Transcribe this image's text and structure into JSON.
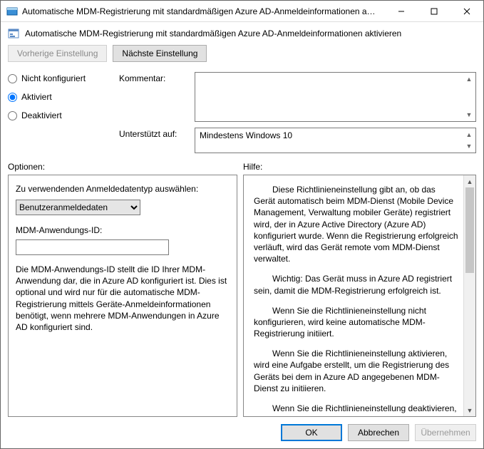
{
  "window": {
    "title": "Automatische MDM-Registrierung mit standardmäßigen Azure AD-Anmeldeinformationen akti..."
  },
  "header": {
    "title": "Automatische MDM-Registrierung mit standardmäßigen Azure AD-Anmeldeinformationen aktivieren"
  },
  "nav": {
    "prev": "Vorherige Einstellung",
    "next": "Nächste Einstellung"
  },
  "radios": {
    "not_configured": "Nicht konfiguriert",
    "enabled": "Aktiviert",
    "disabled": "Deaktiviert"
  },
  "labels": {
    "comment": "Kommentar:",
    "supported": "Unterstützt auf:",
    "options": "Optionen:",
    "help": "Hilfe:"
  },
  "supported_value": "Mindestens Windows 10",
  "options": {
    "cred_type_label": "Zu verwendenden Anmeldedatentyp auswählen:",
    "cred_type_value": "Benutzeranmeldedaten",
    "appid_label": "MDM-Anwendungs-ID:",
    "appid_value": "",
    "desc": "Die MDM-Anwendungs-ID stellt die ID Ihrer MDM-Anwendung dar, die in Azure AD konfiguriert ist. Dies ist optional und wird nur für die automatische MDM-Registrierung mittels Geräte-Anmeldeinformationen benötigt, wenn mehrere MDM-Anwendungen in Azure AD konfiguriert sind."
  },
  "help": {
    "p1": "Diese Richtlinieneinstellung gibt an, ob das Gerät automatisch beim MDM-Dienst (Mobile Device Management, Verwaltung mobiler Geräte) registriert wird, der in Azure Active Directory (Azure AD) konfiguriert wurde. Wenn die Registrierung erfolgreich verläuft, wird das Gerät remote vom MDM-Dienst verwaltet.",
    "p2": "Wichtig: Das Gerät muss in Azure AD registriert sein, damit die MDM-Registrierung erfolgreich ist.",
    "p3": "Wenn Sie die Richtlinieneinstellung nicht konfigurieren, wird keine automatische MDM-Registrierung initiiert.",
    "p4": "Wenn Sie die Richtlinieneinstellung aktivieren, wird eine Aufgabe erstellt, um die Registrierung des Geräts bei dem in Azure AD angegebenen MDM-Dienst zu initiieren.",
    "p5": "Wenn Sie die Richtlinieneinstellung deaktivieren, wird die MDM-Registrierung aufgehoben."
  },
  "buttons": {
    "ok": "OK",
    "cancel": "Abbrechen",
    "apply": "Übernehmen"
  }
}
